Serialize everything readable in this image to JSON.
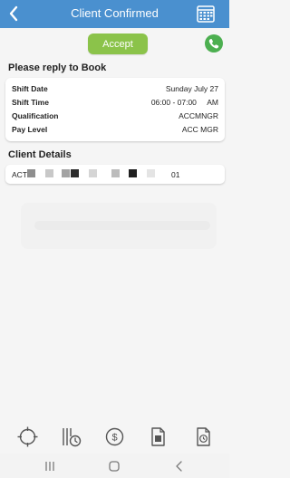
{
  "header": {
    "title": "Client Confirmed",
    "back_icon": "chevron-left-icon",
    "calendar_icon": "calendar-icon"
  },
  "actions": {
    "accept_label": "Accept",
    "phone_icon": "phone-icon"
  },
  "reply_section": {
    "title": "Please reply to Book",
    "rows": [
      {
        "label": "Shift Date",
        "value": "Sunday July 27"
      },
      {
        "label": "Shift Time",
        "value": "06:00 - 07:00     AM"
      },
      {
        "label": "Qualification",
        "value": "ACCMNGR"
      },
      {
        "label": "Pay Level",
        "value": "ACC MGR"
      }
    ]
  },
  "client_section": {
    "title": "Client Details",
    "prefix": "ACT",
    "suffix": "01"
  },
  "bottom_nav": {
    "items": [
      {
        "icon": "compass-icon"
      },
      {
        "icon": "timesheet-clock-icon"
      },
      {
        "icon": "dollar-icon"
      },
      {
        "icon": "document-icon"
      },
      {
        "icon": "document-clock-icon"
      }
    ]
  },
  "system_nav": {
    "recent_icon": "recent-apps-icon",
    "home_icon": "home-icon",
    "back_icon": "system-back-icon"
  },
  "colors": {
    "header_bg": "#4a90cf",
    "accept_bg": "#8bc34a",
    "phone_bg": "#4caf50",
    "page_bg": "#f5f5f5"
  }
}
